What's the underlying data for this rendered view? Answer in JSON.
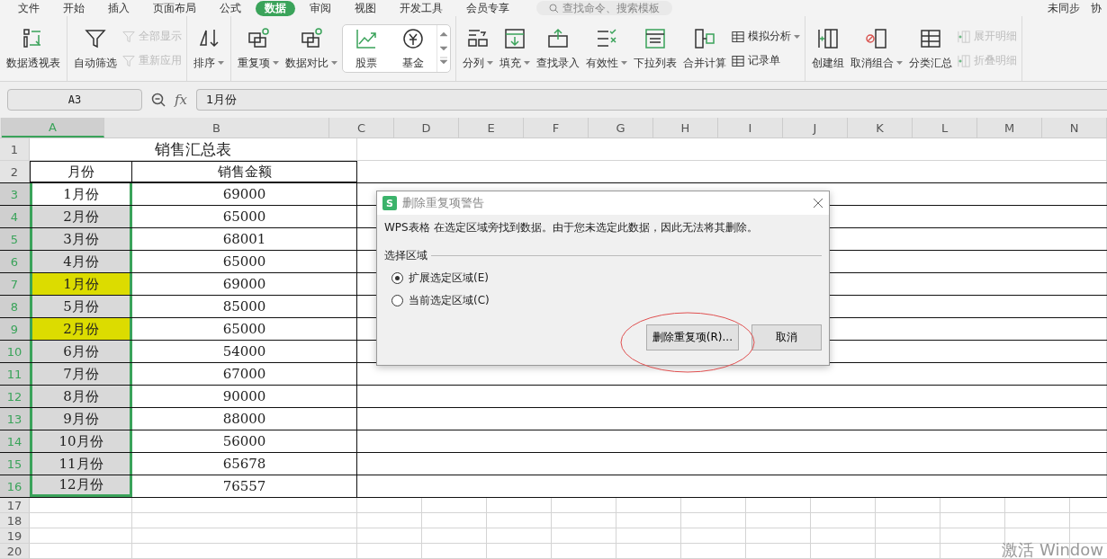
{
  "menu_tabs": [
    {
      "label": "文件",
      "selected": false
    },
    {
      "label": "开始",
      "selected": false
    },
    {
      "label": "插入",
      "selected": false
    },
    {
      "label": "页面布局",
      "selected": false
    },
    {
      "label": "公式",
      "selected": false
    },
    {
      "label": "数据",
      "selected": true
    },
    {
      "label": "审阅",
      "selected": false
    },
    {
      "label": "视图",
      "selected": false
    },
    {
      "label": "开发工具",
      "selected": false
    },
    {
      "label": "会员专享",
      "selected": false
    }
  ],
  "search": {
    "placeholder": "查找命令、搜索模板"
  },
  "sync_status": "未同步",
  "collab": "协",
  "ribbon": {
    "groups": [
      {
        "items": [
          {
            "kind": "big",
            "label": "数据透视表",
            "dropdown": false,
            "disabled": false
          }
        ]
      },
      {
        "items": [
          {
            "kind": "big",
            "label": "自动筛选",
            "dropdown": false,
            "disabled": false
          },
          {
            "kind": "small",
            "label": "全部显示",
            "dropdown": false,
            "disabled": true
          },
          {
            "kind": "small",
            "label": "重新应用",
            "dropdown": false,
            "disabled": true
          }
        ]
      },
      {
        "items": [
          {
            "kind": "big",
            "label": "排序",
            "dropdown": true,
            "disabled": false
          }
        ]
      },
      {
        "items": [
          {
            "kind": "big",
            "label": "重复项",
            "dropdown": true,
            "disabled": false
          },
          {
            "kind": "big",
            "label": "数据对比",
            "dropdown": true,
            "disabled": false
          },
          {
            "kind": "gallery",
            "options": [
              {
                "label": "股票"
              },
              {
                "label": "基金"
              }
            ]
          }
        ]
      },
      {
        "items": [
          {
            "kind": "big",
            "label": "分列",
            "dropdown": true,
            "disabled": false
          },
          {
            "kind": "big",
            "label": "填充",
            "dropdown": true,
            "disabled": false
          },
          {
            "kind": "big",
            "label": "查找录入",
            "dropdown": false,
            "disabled": false
          },
          {
            "kind": "big",
            "label": "有效性",
            "dropdown": true,
            "disabled": false
          },
          {
            "kind": "big",
            "label": "下拉列表",
            "dropdown": false,
            "disabled": false
          },
          {
            "kind": "big",
            "label": "合并计算",
            "dropdown": false,
            "disabled": false
          },
          {
            "kind": "small",
            "label": "模拟分析",
            "dropdown": true,
            "disabled": false
          },
          {
            "kind": "small",
            "label": "记录单",
            "dropdown": false,
            "disabled": false
          }
        ]
      },
      {
        "items": [
          {
            "kind": "big",
            "label": "创建组",
            "dropdown": false,
            "disabled": false
          },
          {
            "kind": "big",
            "label": "取消组合",
            "dropdown": true,
            "disabled": false
          },
          {
            "kind": "big",
            "label": "分类汇总",
            "dropdown": false,
            "disabled": false
          },
          {
            "kind": "small",
            "label": "展开明细",
            "dropdown": false,
            "disabled": true
          },
          {
            "kind": "small",
            "label": "折叠明细",
            "dropdown": false,
            "disabled": true
          }
        ]
      }
    ]
  },
  "formula_bar": {
    "name_box": "A3",
    "fx": "fx",
    "value": "1月份"
  },
  "sheet": {
    "columns": [
      {
        "label": "A",
        "selected": true
      },
      {
        "label": "B",
        "selected": false
      },
      {
        "label": "C",
        "selected": false
      },
      {
        "label": "D",
        "selected": false
      },
      {
        "label": "E",
        "selected": false
      },
      {
        "label": "F",
        "selected": false
      },
      {
        "label": "G",
        "selected": false
      },
      {
        "label": "H",
        "selected": false
      },
      {
        "label": "I",
        "selected": false
      },
      {
        "label": "J",
        "selected": false
      },
      {
        "label": "K",
        "selected": false
      },
      {
        "label": "L",
        "selected": false
      },
      {
        "label": "M",
        "selected": false
      },
      {
        "label": "N",
        "selected": false
      }
    ],
    "rows": [
      {
        "number": "1",
        "kind": "title",
        "selected": false,
        "text": "销售汇总表"
      },
      {
        "number": "2",
        "kind": "header",
        "selected": false,
        "cells": [
          "月份",
          "销售金额"
        ]
      },
      {
        "number": "3",
        "kind": "data",
        "selected": true,
        "cells": [
          "1月份",
          "69000"
        ],
        "color": "#ffffff"
      },
      {
        "number": "4",
        "kind": "data",
        "selected": true,
        "cells": [
          "2月份",
          "65000"
        ],
        "color": "#d9d9d9"
      },
      {
        "number": "5",
        "kind": "data",
        "selected": true,
        "cells": [
          "3月份",
          "68001"
        ],
        "color": "#d9d9d9"
      },
      {
        "number": "6",
        "kind": "data",
        "selected": true,
        "cells": [
          "4月份",
          "65000"
        ],
        "color": "#d9d9d9"
      },
      {
        "number": "7",
        "kind": "data",
        "selected": true,
        "cells": [
          "1月份",
          "69000"
        ],
        "color": "#dcdc00"
      },
      {
        "number": "8",
        "kind": "data",
        "selected": true,
        "cells": [
          "5月份",
          "85000"
        ],
        "color": "#d9d9d9"
      },
      {
        "number": "9",
        "kind": "data",
        "selected": true,
        "cells": [
          "2月份",
          "65000"
        ],
        "color": "#dcdc00"
      },
      {
        "number": "10",
        "kind": "data",
        "selected": true,
        "cells": [
          "6月份",
          "54000"
        ],
        "color": "#d9d9d9"
      },
      {
        "number": "11",
        "kind": "data",
        "selected": true,
        "cells": [
          "7月份",
          "67000"
        ],
        "color": "#d9d9d9"
      },
      {
        "number": "12",
        "kind": "data",
        "selected": true,
        "cells": [
          "8月份",
          "90000"
        ],
        "color": "#d9d9d9"
      },
      {
        "number": "13",
        "kind": "data",
        "selected": true,
        "cells": [
          "9月份",
          "88000"
        ],
        "color": "#d9d9d9"
      },
      {
        "number": "14",
        "kind": "data",
        "selected": true,
        "cells": [
          "10月份",
          "56000"
        ],
        "color": "#d9d9d9"
      },
      {
        "number": "15",
        "kind": "data",
        "selected": true,
        "cells": [
          "11月份",
          "65678"
        ],
        "color": "#d9d9d9"
      },
      {
        "number": "16",
        "kind": "data",
        "selected": true,
        "cells": [
          "12月份",
          "76557"
        ],
        "color": "#d9d9d9"
      },
      {
        "number": "17",
        "kind": "empty",
        "selected": false
      },
      {
        "number": "18",
        "kind": "empty",
        "selected": false
      },
      {
        "number": "19",
        "kind": "empty",
        "selected": false
      },
      {
        "number": "20",
        "kind": "empty",
        "selected": false
      }
    ]
  },
  "dialog": {
    "title": "删除重复项警告",
    "app_badge": "S",
    "message": "WPS表格 在选定区域旁找到数据。由于您未选定此数据，因此无法将其删除。",
    "group_label": "选择区域",
    "options": [
      {
        "label": "扩展选定区域(E)",
        "selected": true
      },
      {
        "label": "当前选定区域(C)",
        "selected": false
      }
    ],
    "buttons": [
      {
        "label": "删除重复项(R)...",
        "kind": "primary"
      },
      {
        "label": "取消",
        "kind": "cancel"
      }
    ]
  },
  "activation_notice": "激活 Window"
}
